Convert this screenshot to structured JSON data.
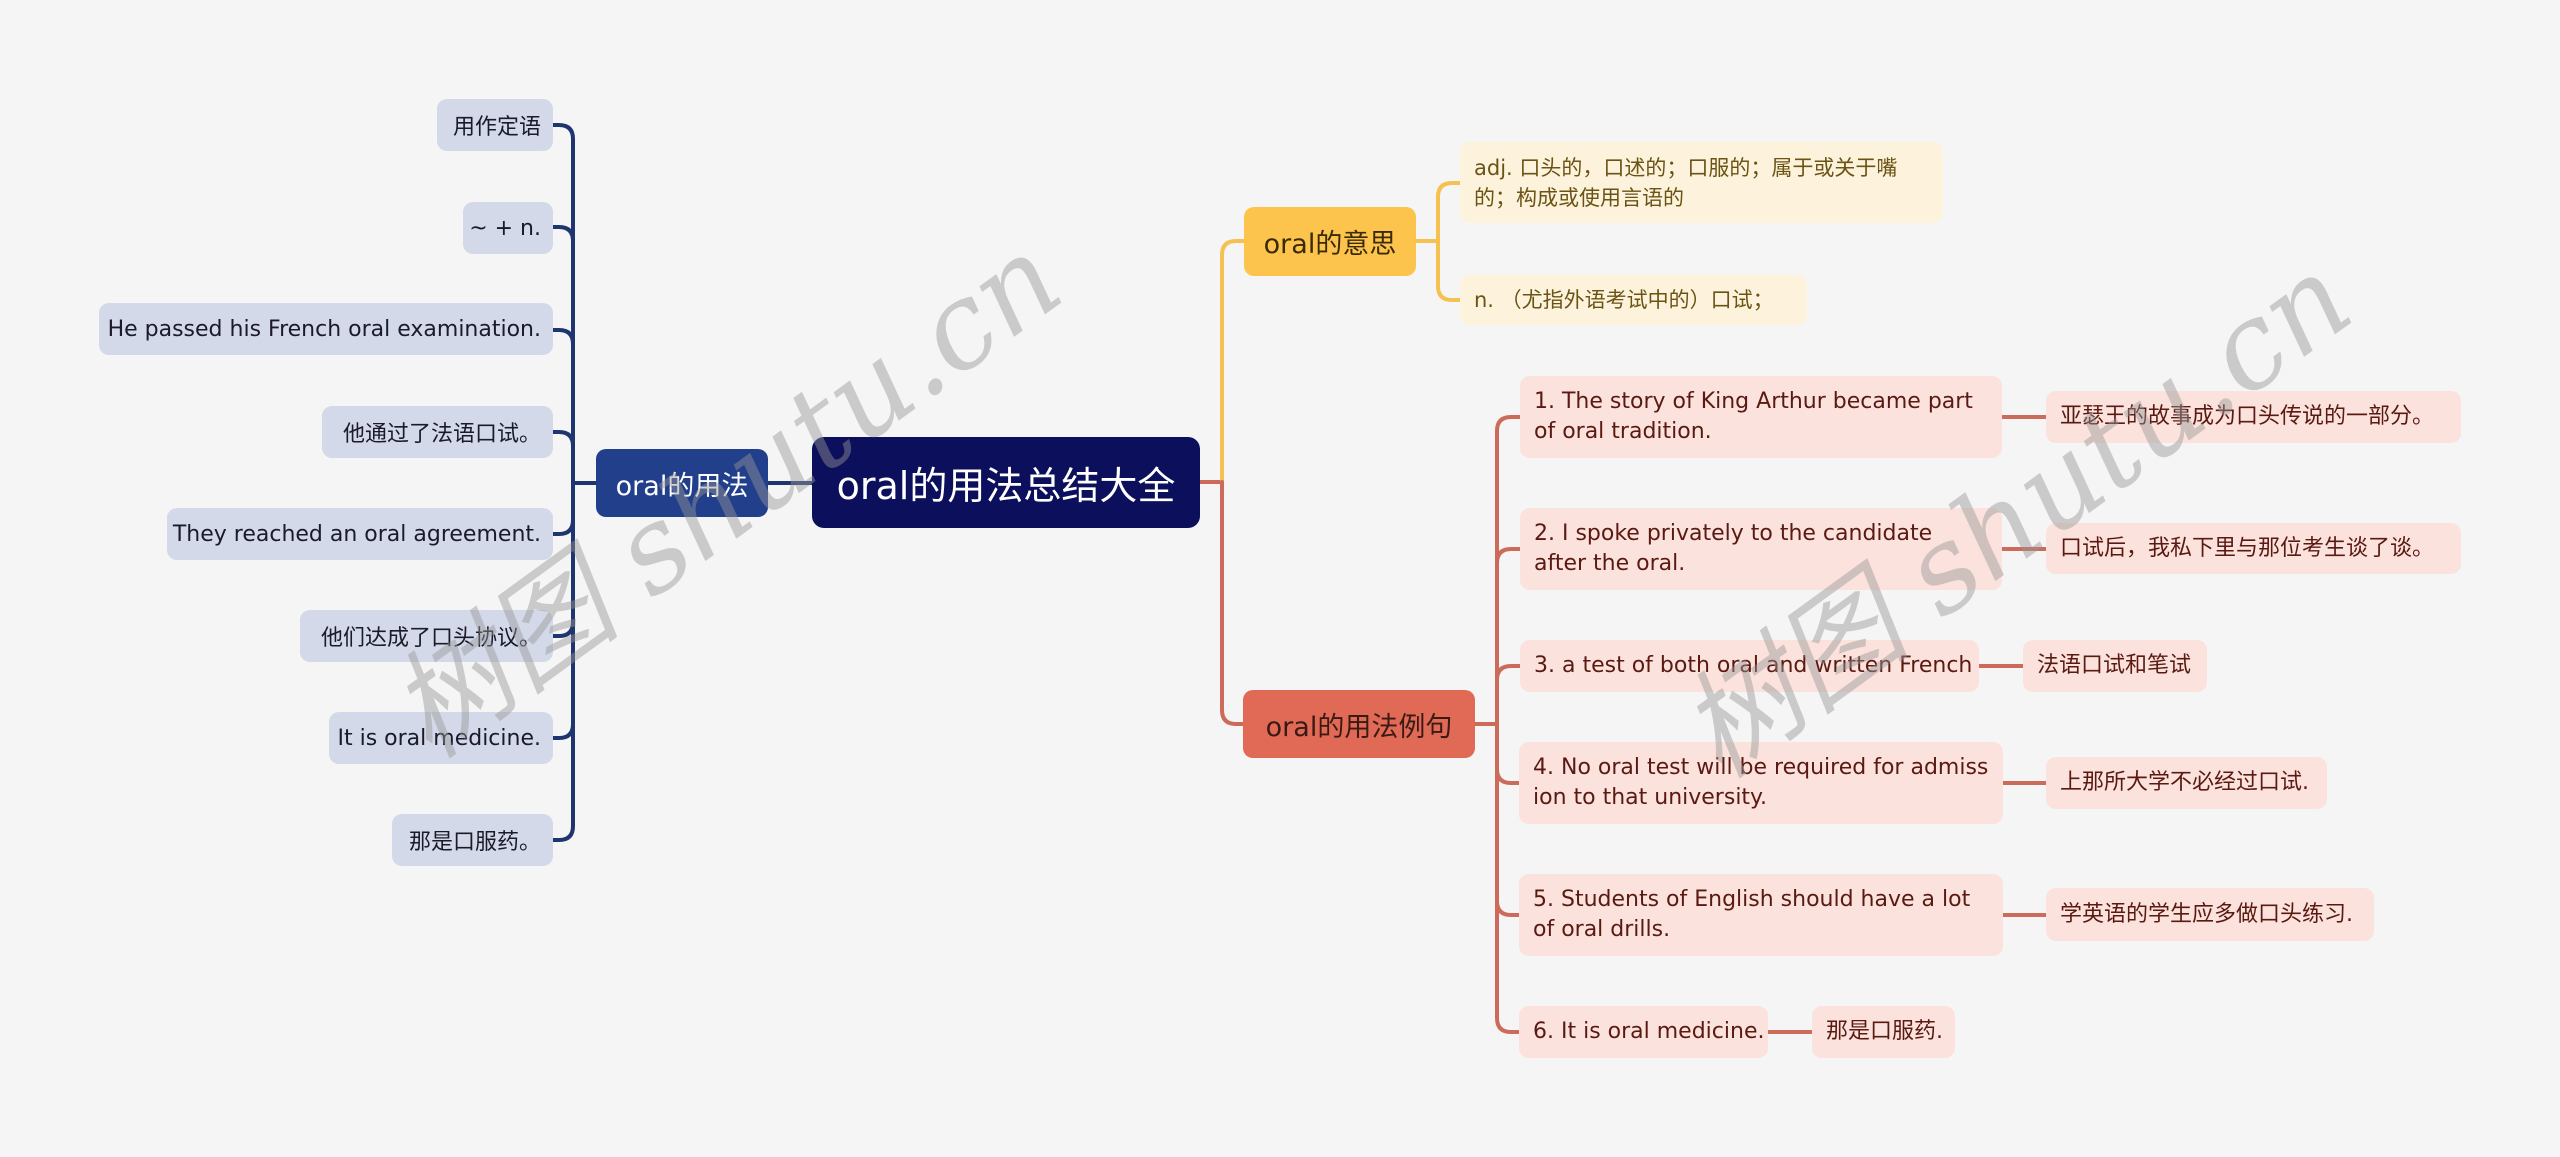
{
  "root": {
    "label": "oral的用法总结大全"
  },
  "branches": {
    "usage": {
      "label": "oral的用法",
      "items": [
        "用作定语",
        "~ + n.",
        "He passed his French oral examination.",
        "他通过了法语口试。",
        "They reached an oral agreement.",
        "他们达成了口头协议。",
        "It is oral medicine.",
        "那是口服药。"
      ]
    },
    "meaning": {
      "label": "oral的意思",
      "items": [
        "adj. 口头的，口述的；口服的；属于或关于嘴的；构成或使用言语的",
        "n. （尤指外语考试中的）口试；"
      ]
    },
    "examples": {
      "label": "oral的用法例句",
      "items": [
        {
          "en": "1. The story of King Arthur became part of oral tradition.",
          "zh": "亚瑟王的故事成为口头传说的一部分。"
        },
        {
          "en": "2. I spoke privately to the candidate after the oral.",
          "zh": "口试后，我私下里与那位考生谈了谈。"
        },
        {
          "en": "3. a test of both oral and written French",
          "zh": "法语口试和笔试"
        },
        {
          "en": "4. No oral test will be required for admission to that university.",
          "zh": "上那所大学不必经过口试."
        },
        {
          "en": "5. Students of English should have a lot of oral drills.",
          "zh": "学英语的学生应多做口头练习."
        },
        {
          "en": "6. It is oral medicine.",
          "zh": "那是口服药."
        }
      ]
    }
  },
  "colors": {
    "root": "#0b0f5c",
    "usage_branch": "#223f8c",
    "usage_line": "#1e3570",
    "meaning_branch": "#fcc44c",
    "meaning_line": "#f5c150",
    "examples_branch": "#e06a55",
    "examples_line": "#cc6b5a"
  },
  "watermark": {
    "text": "树图 shutu.cn"
  }
}
